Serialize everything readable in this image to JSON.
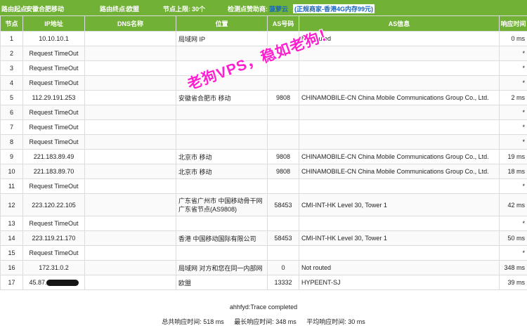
{
  "header": {
    "start_label": "路由起点:",
    "start_value": "安徽合肥移动",
    "end_label": "路由终点:",
    "end_value": "欧盟",
    "hops_label": "节点上限:",
    "hops_value": "30个",
    "sponsor_label": "检测点赞助商:",
    "sponsor_name": "菠萝云",
    "sponsor_ad": "(正规商家-香港4G内存99元)"
  },
  "columns": {
    "hop": "节点",
    "ip": "IP地址",
    "dns": "DNS名称",
    "location": "位置",
    "asn": "AS号码",
    "as_info": "AS信息",
    "time": "响应时间"
  },
  "rows": [
    {
      "hop": "1",
      "ip": "10.10.10.1",
      "dns": "",
      "location": "局域网 IP",
      "asn": "",
      "as_info": "Not routed",
      "time": "0 ms"
    },
    {
      "hop": "2",
      "ip": "Request TimeOut",
      "dns": "",
      "location": "",
      "asn": "",
      "as_info": "",
      "time": "*"
    },
    {
      "hop": "3",
      "ip": "Request TimeOut",
      "dns": "",
      "location": "",
      "asn": "",
      "as_info": "",
      "time": "*"
    },
    {
      "hop": "4",
      "ip": "Request TimeOut",
      "dns": "",
      "location": "",
      "asn": "",
      "as_info": "",
      "time": "*"
    },
    {
      "hop": "5",
      "ip": "112.29.191.253",
      "dns": "",
      "location": "安徽省合肥市 移动",
      "asn": "9808",
      "as_info": "CHINAMOBILE-CN China Mobile Communications Group Co., Ltd.",
      "time": "2 ms"
    },
    {
      "hop": "6",
      "ip": "Request TimeOut",
      "dns": "",
      "location": "",
      "asn": "",
      "as_info": "",
      "time": "*"
    },
    {
      "hop": "7",
      "ip": "Request TimeOut",
      "dns": "",
      "location": "",
      "asn": "",
      "as_info": "",
      "time": "*"
    },
    {
      "hop": "8",
      "ip": "Request TimeOut",
      "dns": "",
      "location": "",
      "asn": "",
      "as_info": "",
      "time": "*"
    },
    {
      "hop": "9",
      "ip": "221.183.89.49",
      "dns": "",
      "location": "北京市 移动",
      "asn": "9808",
      "as_info": "CHINAMOBILE-CN China Mobile Communications Group Co., Ltd.",
      "time": "19 ms"
    },
    {
      "hop": "10",
      "ip": "221.183.89.70",
      "dns": "",
      "location": "北京市 移动",
      "asn": "9808",
      "as_info": "CHINAMOBILE-CN China Mobile Communications Group Co., Ltd.",
      "time": "18 ms"
    },
    {
      "hop": "11",
      "ip": "Request TimeOut",
      "dns": "",
      "location": "",
      "asn": "",
      "as_info": "",
      "time": "*"
    },
    {
      "hop": "12",
      "ip": "223.120.22.105",
      "dns": "",
      "location": "广东省广州市 中国移动骨干网广东省节点(AS9808)",
      "asn": "58453",
      "as_info": "CMI-INT-HK Level 30, Tower 1",
      "time": "42 ms"
    },
    {
      "hop": "13",
      "ip": "Request TimeOut",
      "dns": "",
      "location": "",
      "asn": "",
      "as_info": "",
      "time": "*"
    },
    {
      "hop": "14",
      "ip": "223.119.21.170",
      "dns": "",
      "location": "香港 中国移动国际有限公司",
      "asn": "58453",
      "as_info": "CMI-INT-HK Level 30, Tower 1",
      "time": "50 ms"
    },
    {
      "hop": "15",
      "ip": "Request TimeOut",
      "dns": "",
      "location": "",
      "asn": "",
      "as_info": "",
      "time": "*"
    },
    {
      "hop": "16",
      "ip": "172.31.0.2",
      "dns": "",
      "location": "局域网 对方和您在同一内部网",
      "asn": "0",
      "as_info": "Not routed",
      "time": "348 ms"
    },
    {
      "hop": "17",
      "ip": "45.87.",
      "dns": "",
      "location": "欧盟",
      "asn": "13332",
      "as_info": "HYPEENT-SJ",
      "time": "39 ms",
      "redacted": true
    }
  ],
  "footer": {
    "status": "ahhfyd:Trace completed",
    "total_time": "总共响应时间: 518 ms",
    "max_time": "最长响应时间: 348 ms",
    "avg_time": "平均响应时间: 30 ms"
  },
  "watermark": "老狗VPS，稳如老狗！",
  "colors": {
    "header_bg": "#71b136",
    "sponsor_text": "#1565c0",
    "watermark": "#ff1fd0"
  }
}
